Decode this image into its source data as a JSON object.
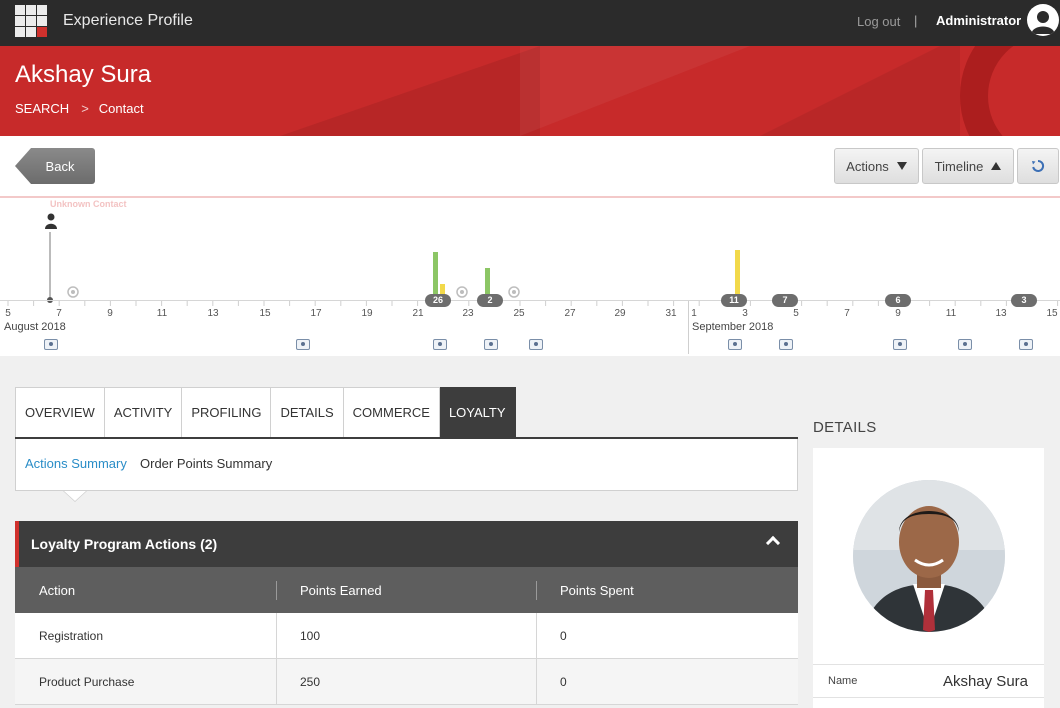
{
  "app": {
    "title": "Experience Profile",
    "logout": "Log out",
    "separator": "|",
    "user": "Administrator"
  },
  "header": {
    "contact_name": "Akshay Sura",
    "breadcrumb": [
      "SEARCH",
      "Contact"
    ]
  },
  "toolbar": {
    "back": "Back",
    "actions": "Actions",
    "timeline": "Timeline",
    "refresh_icon": "refresh-icon"
  },
  "timeline": {
    "unknown_label": "Unknown Contact",
    "august_ticks": [
      "5",
      "7",
      "9",
      "11",
      "13",
      "15",
      "17",
      "19",
      "21",
      "23",
      "25",
      "27",
      "29",
      "31"
    ],
    "september_ticks": [
      "1",
      "3",
      "5",
      "7",
      "9",
      "11",
      "13",
      "15"
    ],
    "month_august": "August 2018",
    "month_september": "September 2018",
    "badges": [
      "26",
      "2",
      "11",
      "7",
      "6",
      "3"
    ],
    "colors": {
      "green": "#8cc665",
      "yellow": "#f2d94a",
      "badge": "#6d6d6d"
    }
  },
  "tabs": [
    "OVERVIEW",
    "ACTIVITY",
    "PROFILING",
    "DETAILS",
    "COMMERCE",
    "LOYALTY"
  ],
  "active_tab": "LOYALTY",
  "subtabs": [
    "Actions Summary",
    "Order Points Summary"
  ],
  "loyalty": {
    "title": "Loyalty Program Actions (2)",
    "columns": [
      "Action",
      "Points Earned",
      "Points Spent"
    ],
    "rows": [
      [
        "Registration",
        "100",
        "0"
      ],
      [
        "Product Purchase",
        "250",
        "0"
      ]
    ]
  },
  "details": {
    "heading": "DETAILS",
    "name_label": "Name",
    "name_value": "Akshay Sura"
  },
  "colors": {
    "accent": "#c72a2a",
    "topbar": "#2b2b2b",
    "link": "#2a8dc7",
    "panel": "#3d3d3d"
  }
}
